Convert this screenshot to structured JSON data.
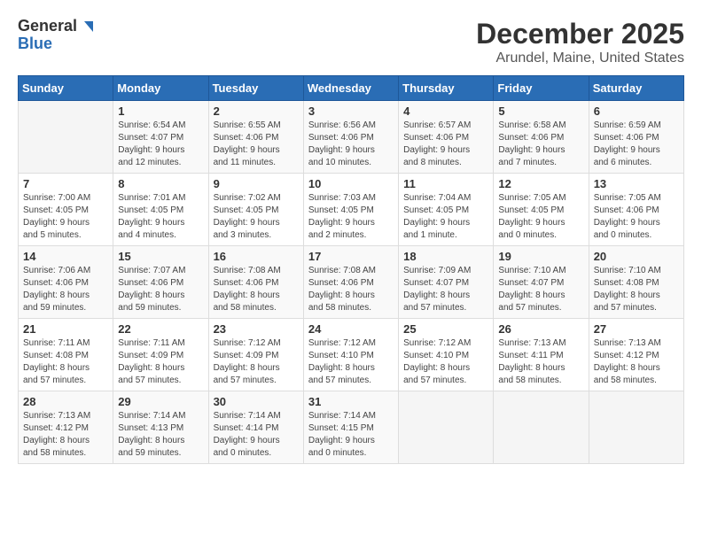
{
  "logo": {
    "general": "General",
    "blue": "Blue"
  },
  "title": "December 2025",
  "location": "Arundel, Maine, United States",
  "days_header": [
    "Sunday",
    "Monday",
    "Tuesday",
    "Wednesday",
    "Thursday",
    "Friday",
    "Saturday"
  ],
  "weeks": [
    [
      {
        "day": "",
        "info": ""
      },
      {
        "day": "1",
        "info": "Sunrise: 6:54 AM\nSunset: 4:07 PM\nDaylight: 9 hours\nand 12 minutes."
      },
      {
        "day": "2",
        "info": "Sunrise: 6:55 AM\nSunset: 4:06 PM\nDaylight: 9 hours\nand 11 minutes."
      },
      {
        "day": "3",
        "info": "Sunrise: 6:56 AM\nSunset: 4:06 PM\nDaylight: 9 hours\nand 10 minutes."
      },
      {
        "day": "4",
        "info": "Sunrise: 6:57 AM\nSunset: 4:06 PM\nDaylight: 9 hours\nand 8 minutes."
      },
      {
        "day": "5",
        "info": "Sunrise: 6:58 AM\nSunset: 4:06 PM\nDaylight: 9 hours\nand 7 minutes."
      },
      {
        "day": "6",
        "info": "Sunrise: 6:59 AM\nSunset: 4:06 PM\nDaylight: 9 hours\nand 6 minutes."
      }
    ],
    [
      {
        "day": "7",
        "info": "Sunrise: 7:00 AM\nSunset: 4:05 PM\nDaylight: 9 hours\nand 5 minutes."
      },
      {
        "day": "8",
        "info": "Sunrise: 7:01 AM\nSunset: 4:05 PM\nDaylight: 9 hours\nand 4 minutes."
      },
      {
        "day": "9",
        "info": "Sunrise: 7:02 AM\nSunset: 4:05 PM\nDaylight: 9 hours\nand 3 minutes."
      },
      {
        "day": "10",
        "info": "Sunrise: 7:03 AM\nSunset: 4:05 PM\nDaylight: 9 hours\nand 2 minutes."
      },
      {
        "day": "11",
        "info": "Sunrise: 7:04 AM\nSunset: 4:05 PM\nDaylight: 9 hours\nand 1 minute."
      },
      {
        "day": "12",
        "info": "Sunrise: 7:05 AM\nSunset: 4:05 PM\nDaylight: 9 hours\nand 0 minutes."
      },
      {
        "day": "13",
        "info": "Sunrise: 7:05 AM\nSunset: 4:06 PM\nDaylight: 9 hours\nand 0 minutes."
      }
    ],
    [
      {
        "day": "14",
        "info": "Sunrise: 7:06 AM\nSunset: 4:06 PM\nDaylight: 8 hours\nand 59 minutes."
      },
      {
        "day": "15",
        "info": "Sunrise: 7:07 AM\nSunset: 4:06 PM\nDaylight: 8 hours\nand 59 minutes."
      },
      {
        "day": "16",
        "info": "Sunrise: 7:08 AM\nSunset: 4:06 PM\nDaylight: 8 hours\nand 58 minutes."
      },
      {
        "day": "17",
        "info": "Sunrise: 7:08 AM\nSunset: 4:06 PM\nDaylight: 8 hours\nand 58 minutes."
      },
      {
        "day": "18",
        "info": "Sunrise: 7:09 AM\nSunset: 4:07 PM\nDaylight: 8 hours\nand 57 minutes."
      },
      {
        "day": "19",
        "info": "Sunrise: 7:10 AM\nSunset: 4:07 PM\nDaylight: 8 hours\nand 57 minutes."
      },
      {
        "day": "20",
        "info": "Sunrise: 7:10 AM\nSunset: 4:08 PM\nDaylight: 8 hours\nand 57 minutes."
      }
    ],
    [
      {
        "day": "21",
        "info": "Sunrise: 7:11 AM\nSunset: 4:08 PM\nDaylight: 8 hours\nand 57 minutes."
      },
      {
        "day": "22",
        "info": "Sunrise: 7:11 AM\nSunset: 4:09 PM\nDaylight: 8 hours\nand 57 minutes."
      },
      {
        "day": "23",
        "info": "Sunrise: 7:12 AM\nSunset: 4:09 PM\nDaylight: 8 hours\nand 57 minutes."
      },
      {
        "day": "24",
        "info": "Sunrise: 7:12 AM\nSunset: 4:10 PM\nDaylight: 8 hours\nand 57 minutes."
      },
      {
        "day": "25",
        "info": "Sunrise: 7:12 AM\nSunset: 4:10 PM\nDaylight: 8 hours\nand 57 minutes."
      },
      {
        "day": "26",
        "info": "Sunrise: 7:13 AM\nSunset: 4:11 PM\nDaylight: 8 hours\nand 58 minutes."
      },
      {
        "day": "27",
        "info": "Sunrise: 7:13 AM\nSunset: 4:12 PM\nDaylight: 8 hours\nand 58 minutes."
      }
    ],
    [
      {
        "day": "28",
        "info": "Sunrise: 7:13 AM\nSunset: 4:12 PM\nDaylight: 8 hours\nand 58 minutes."
      },
      {
        "day": "29",
        "info": "Sunrise: 7:14 AM\nSunset: 4:13 PM\nDaylight: 8 hours\nand 59 minutes."
      },
      {
        "day": "30",
        "info": "Sunrise: 7:14 AM\nSunset: 4:14 PM\nDaylight: 9 hours\nand 0 minutes."
      },
      {
        "day": "31",
        "info": "Sunrise: 7:14 AM\nSunset: 4:15 PM\nDaylight: 9 hours\nand 0 minutes."
      },
      {
        "day": "",
        "info": ""
      },
      {
        "day": "",
        "info": ""
      },
      {
        "day": "",
        "info": ""
      }
    ]
  ]
}
